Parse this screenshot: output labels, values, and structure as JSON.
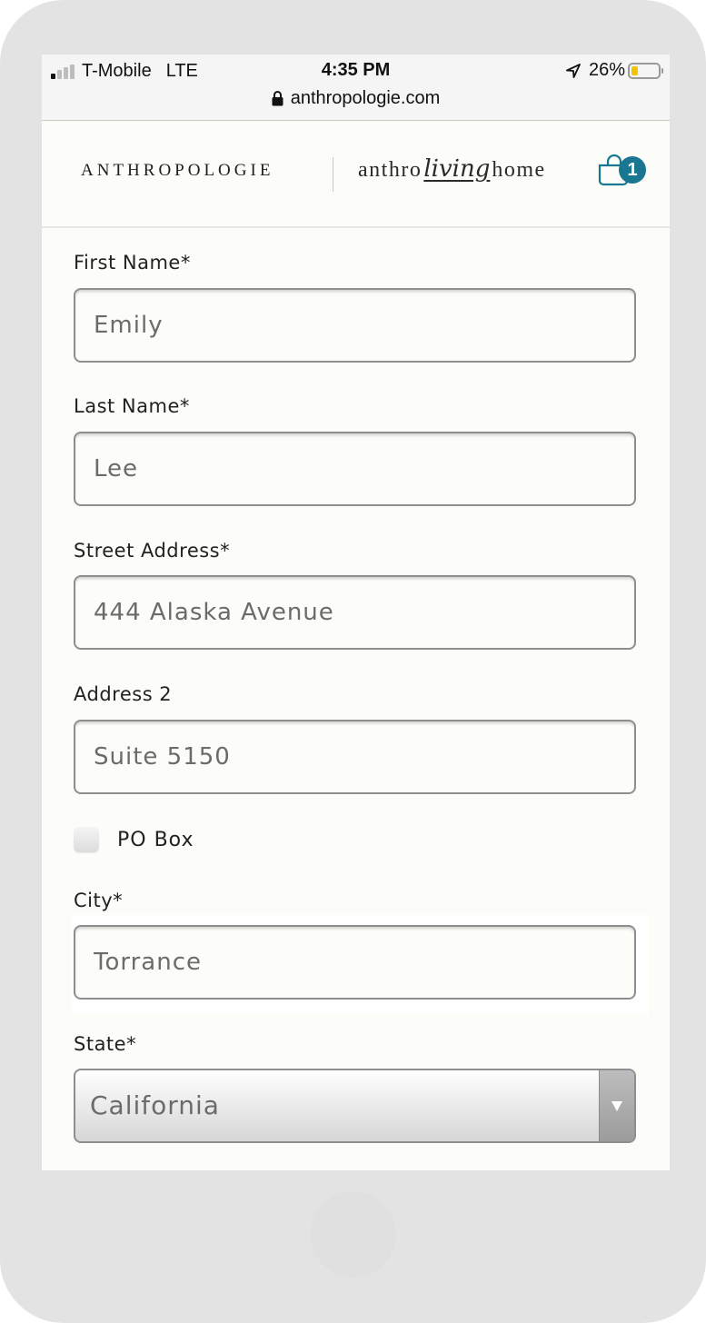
{
  "status_bar": {
    "carrier": "T-Mobile",
    "network": "LTE",
    "time": "4:35 PM",
    "battery_percent": "26%",
    "battery_level": 0.26,
    "battery_color": "#f4c400",
    "url": "anthropologie.com",
    "signal_bars_active": 1,
    "signal_bars_total": 4
  },
  "header": {
    "brand_primary": "ANTHROPOLOGIE",
    "brand_secondary_prefix": "anthro",
    "brand_secondary_script": "living",
    "brand_secondary_suffix": "home",
    "cart_count": "1",
    "accent_color": "#1a7791"
  },
  "form": {
    "first_name": {
      "label": "First Name*",
      "value": "Emily"
    },
    "last_name": {
      "label": "Last Name*",
      "value": "Lee"
    },
    "street_address": {
      "label": "Street Address*",
      "value": "444 Alaska Avenue"
    },
    "address_2": {
      "label": "Address 2",
      "value": "Suite 5150"
    },
    "po_box": {
      "label": "PO Box",
      "checked": false
    },
    "city": {
      "label": "City*",
      "value": "Torrance"
    },
    "state": {
      "label": "State*",
      "value": "California"
    }
  }
}
